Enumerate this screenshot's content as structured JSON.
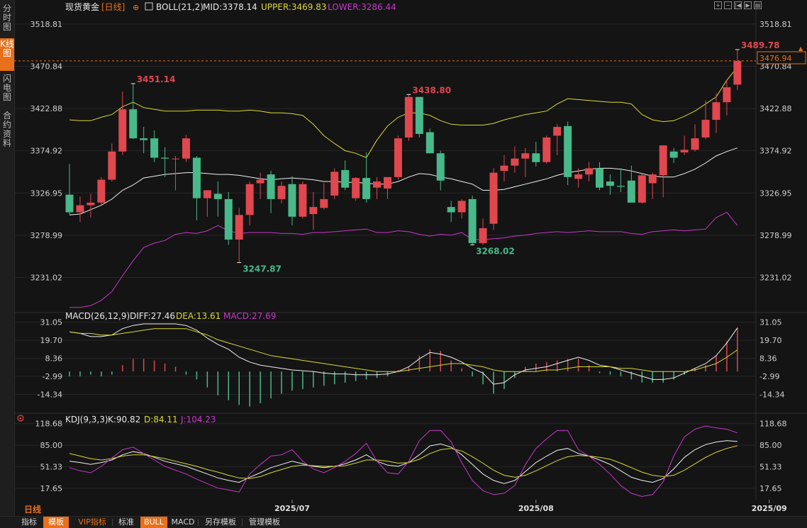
{
  "sidebar": {
    "tabs": [
      {
        "label": "分时图",
        "active": false
      },
      {
        "label": "K线图",
        "active": true
      },
      {
        "label": "闪电图",
        "active": false
      },
      {
        "label": "合约资料",
        "active": false
      }
    ]
  },
  "header": {
    "symbol": "现货黄金",
    "period": "[日线]",
    "boll_label": "BOLL(21,2)",
    "mid_label": "MID:3378.14",
    "upper_label": "UPPER:3469.83",
    "lower_label": "LOWER:3286.44"
  },
  "colors": {
    "background": "#141414",
    "up": "#e0474f",
    "down": "#48b98a",
    "mid": "#f0f0f0",
    "upper": "#d9d935",
    "lower": "#c838c8",
    "dea": "#d9d935",
    "macd": "#c838c8",
    "axis_text": "#cfcfcf",
    "accent": "#e8701a"
  },
  "macd_header": {
    "label": "MACD(26,12,9)",
    "diff": "DIFF:27.46",
    "dea": "DEA:13.61",
    "macd": "MACD:27.69"
  },
  "kdj_header": {
    "label": "KDJ(9,3,3)",
    "k": "K:90.82",
    "d": "D:84.11",
    "j": "J:104.23"
  },
  "period_label": "日线",
  "current_price_tag": "3476.94",
  "toolbar": {
    "items": [
      {
        "label": "指标",
        "active": false,
        "vip": false
      },
      {
        "label": "模板",
        "active": true,
        "vip": false
      },
      {
        "label": "VIP指标",
        "active": false,
        "vip": true
      },
      {
        "label": "标准",
        "active": false,
        "vip": false
      },
      {
        "label": "BULL",
        "active": true,
        "vip": false
      },
      {
        "label": "MACD",
        "active": false,
        "vip": false
      },
      {
        "label": "另存模板",
        "active": false,
        "vip": false
      },
      {
        "label": "管理模板",
        "active": false,
        "vip": false
      }
    ]
  },
  "chart_data": [
    {
      "type": "candlestick",
      "title": "现货黄金 日线",
      "ylim": [
        3200,
        3530
      ],
      "y_ticks": [
        "3518.81",
        "3470.84",
        "3422.88",
        "3374.92",
        "3326.95",
        "3278.99",
        "3231.02"
      ],
      "x_ticks": [
        {
          "index": 21,
          "label": "2025/07"
        },
        {
          "index": 44,
          "label": "2025/08"
        },
        {
          "index": 66,
          "label": "2025/09"
        }
      ],
      "candles": [
        [
          3325,
          3360,
          3302,
          3305
        ],
        [
          3305,
          3323,
          3294,
          3313
        ],
        [
          3313,
          3326,
          3299,
          3316
        ],
        [
          3316,
          3345,
          3313,
          3342
        ],
        [
          3342,
          3383,
          3340,
          3374
        ],
        [
          3374,
          3442,
          3370,
          3422
        ],
        [
          3422,
          3451.14,
          3388,
          3389
        ],
        [
          3389,
          3402,
          3372,
          3387
        ],
        [
          3389,
          3398,
          3362,
          3367
        ],
        [
          3367,
          3379,
          3345,
          3366
        ],
        [
          3366,
          3369,
          3330,
          3366
        ],
        [
          3366,
          3393,
          3362,
          3389
        ],
        [
          3367,
          3369,
          3296,
          3321
        ],
        [
          3321,
          3330,
          3300,
          3330
        ],
        [
          3326,
          3340,
          3300,
          3320
        ],
        [
          3320,
          3328,
          3268,
          3274
        ],
        [
          3274,
          3310,
          3247.87,
          3302
        ],
        [
          3302,
          3340,
          3290,
          3337
        ],
        [
          3338,
          3350,
          3320,
          3342
        ],
        [
          3348,
          3352,
          3304,
          3320
        ],
        [
          3320,
          3340,
          3315,
          3335
        ],
        [
          3337,
          3346,
          3290,
          3300
        ],
        [
          3300,
          3340,
          3298,
          3337
        ],
        [
          3303,
          3328,
          3285,
          3311
        ],
        [
          3310,
          3338,
          3308,
          3320
        ],
        [
          3324,
          3355,
          3320,
          3351
        ],
        [
          3353,
          3364,
          3330,
          3333
        ],
        [
          3321,
          3345,
          3318,
          3344
        ],
        [
          3344,
          3373,
          3316,
          3320
        ],
        [
          3333,
          3345,
          3320,
          3340
        ],
        [
          3332,
          3343,
          3320,
          3345
        ],
        [
          3345,
          3392,
          3342,
          3389
        ],
        [
          3390,
          3438.8,
          3386,
          3436
        ],
        [
          3436,
          3436,
          3390,
          3394
        ],
        [
          3396,
          3400,
          3372,
          3372
        ],
        [
          3372,
          3375,
          3330,
          3341
        ],
        [
          3311,
          3318,
          3294,
          3305
        ],
        [
          3305,
          3320,
          3298,
          3318
        ],
        [
          3320,
          3324,
          3268.02,
          3270
        ],
        [
          3270,
          3298,
          3268,
          3287
        ],
        [
          3292,
          3355,
          3285,
          3350
        ],
        [
          3352,
          3370,
          3340,
          3358
        ],
        [
          3358,
          3380,
          3350,
          3366
        ],
        [
          3366,
          3378,
          3345,
          3372
        ],
        [
          3372,
          3385,
          3357,
          3362
        ],
        [
          3362,
          3392,
          3360,
          3390
        ],
        [
          3392,
          3405,
          3370,
          3402
        ],
        [
          3403,
          3408,
          3336,
          3345
        ],
        [
          3343,
          3355,
          3333,
          3348
        ],
        [
          3348,
          3362,
          3340,
          3355
        ],
        [
          3355,
          3362,
          3330,
          3333
        ],
        [
          3340,
          3348,
          3325,
          3335
        ],
        [
          3335,
          3355,
          3328,
          3334
        ],
        [
          3341,
          3358,
          3322,
          3316
        ],
        [
          3316,
          3350,
          3315,
          3347
        ],
        [
          3338,
          3350,
          3320,
          3348
        ],
        [
          3347,
          3381,
          3322,
          3381
        ],
        [
          3374,
          3378,
          3361,
          3367
        ],
        [
          3373,
          3392,
          3370,
          3376
        ],
        [
          3376,
          3405,
          3374,
          3389
        ],
        [
          3390,
          3432,
          3388,
          3410
        ],
        [
          3410,
          3440,
          3395,
          3430
        ],
        [
          3430,
          3455,
          3415,
          3447
        ],
        [
          3450,
          3489.78,
          3444,
          3476.94
        ]
      ],
      "series": [
        {
          "name": "MID",
          "values": [
            3302,
            3303,
            3308,
            3313,
            3320,
            3330,
            3336,
            3344,
            3346,
            3348,
            3349,
            3350,
            3350,
            3349,
            3348,
            3348,
            3347,
            3345,
            3343,
            3342,
            3343,
            3344,
            3343,
            3342,
            3340,
            3340,
            3339,
            3339,
            3338,
            3337,
            3337,
            3340,
            3345,
            3349,
            3348,
            3345,
            3343,
            3340,
            3337,
            3330,
            3330,
            3331,
            3334,
            3337,
            3340,
            3343,
            3347,
            3350,
            3352,
            3354,
            3355,
            3355,
            3354,
            3352,
            3349,
            3346,
            3345,
            3345,
            3349,
            3354,
            3361,
            3369,
            3374,
            3378.14
          ]
        },
        {
          "name": "UPPER",
          "values": [
            3410,
            3409,
            3409,
            3413,
            3416,
            3425,
            3430,
            3424,
            3422,
            3420,
            3420,
            3420,
            3421,
            3421,
            3421,
            3420,
            3420,
            3421,
            3420,
            3418,
            3418,
            3417,
            3415,
            3405,
            3392,
            3383,
            3375,
            3372,
            3367,
            3387,
            3403,
            3413,
            3418,
            3418,
            3415,
            3409,
            3405,
            3404,
            3404,
            3404,
            3406,
            3410,
            3413,
            3416,
            3418,
            3420,
            3428,
            3434,
            3433,
            3432,
            3431,
            3430,
            3430,
            3428,
            3416,
            3410,
            3408,
            3409,
            3414,
            3420,
            3428,
            3436,
            3455,
            3469.83
          ]
        },
        {
          "name": "LOWER",
          "values": [
            3197,
            3197,
            3199,
            3205,
            3215,
            3233,
            3250,
            3265,
            3270,
            3273,
            3280,
            3282,
            3281,
            3284,
            3290,
            3284,
            3281,
            3282,
            3282,
            3282,
            3281,
            3281,
            3280,
            3282,
            3282,
            3283,
            3284,
            3285,
            3286,
            3282,
            3282,
            3284,
            3283,
            3280,
            3278,
            3280,
            3279,
            3282,
            3274,
            3274,
            3275,
            3276,
            3278,
            3279,
            3281,
            3282,
            3283,
            3282,
            3283,
            3284,
            3283,
            3283,
            3283,
            3281,
            3280,
            3283,
            3284,
            3285,
            3284,
            3285,
            3286,
            3299,
            3305,
            3290
          ]
        }
      ]
    },
    {
      "type": "bar",
      "title": "MACD(26,12,9)",
      "ylim": [
        -24,
        34
      ],
      "y_ticks": [
        "31.05",
        "19.70",
        "8.36",
        "-2.99",
        "-14.34"
      ],
      "series": [
        {
          "name": "DIFF",
          "values": [
            25,
            24,
            22,
            22,
            23,
            27,
            29,
            30,
            30,
            30,
            30,
            29,
            26,
            21,
            17,
            14,
            9,
            6,
            4,
            3,
            2,
            1,
            0.5,
            0,
            -1,
            -1.5,
            -1.5,
            -2,
            -2,
            -2,
            -1.5,
            0,
            3,
            8,
            12,
            11,
            9,
            6,
            2,
            -1,
            -8,
            -7,
            -2,
            1,
            2,
            3,
            5,
            7,
            9,
            7,
            4,
            3,
            1,
            -1,
            -3,
            -5,
            -5,
            -4,
            -1,
            2,
            5,
            10,
            18,
            27.46
          ]
        },
        {
          "name": "DEA",
          "values": [
            25,
            24,
            24,
            23,
            23,
            24,
            25,
            26,
            27,
            27,
            27,
            27,
            25,
            23,
            20,
            18,
            16,
            14,
            12,
            10,
            9,
            8,
            7,
            6,
            5,
            4,
            3,
            2,
            1,
            0,
            0,
            0,
            1,
            2,
            3,
            4,
            5,
            5,
            4,
            3,
            1,
            0,
            0,
            0,
            0,
            1,
            1,
            2,
            3,
            3,
            3,
            3,
            2,
            2,
            1,
            0,
            0,
            0,
            0,
            1,
            3,
            5,
            9,
            13.61
          ]
        },
        {
          "name": "MACD",
          "values": [
            -3,
            -3,
            -2,
            -3,
            -2,
            4,
            8,
            8,
            7,
            5,
            3,
            -2,
            -5,
            -10,
            -15,
            -18,
            -21,
            -22,
            -20,
            -17,
            -14,
            -12,
            -11,
            -10,
            -9,
            -8,
            -7,
            -6,
            -5,
            -4,
            -3,
            1,
            3,
            10,
            14,
            13,
            7,
            2,
            -3,
            -8,
            -14,
            -11,
            -4,
            3,
            5,
            6,
            7,
            8,
            8,
            4,
            -1,
            -2,
            -3,
            -5,
            -7,
            -7,
            -7,
            -5,
            -2,
            2,
            4,
            10,
            19,
            27.69
          ]
        }
      ]
    },
    {
      "type": "line",
      "title": "KDJ(9,3,3)",
      "ylim": [
        0,
        125
      ],
      "y_ticks": [
        "118.68",
        "85.00",
        "51.33",
        "17.65"
      ],
      "series": [
        {
          "name": "K",
          "values": [
            60,
            58,
            55,
            58,
            62,
            70,
            75,
            72,
            66,
            60,
            56,
            52,
            46,
            40,
            34,
            30,
            27,
            35,
            42,
            50,
            55,
            60,
            56,
            52,
            50,
            52,
            56,
            62,
            70,
            60,
            54,
            52,
            58,
            70,
            84,
            87,
            82,
            70,
            55,
            40,
            30,
            25,
            30,
            44,
            58,
            68,
            77,
            80,
            72,
            68,
            62,
            55,
            45,
            35,
            30,
            27,
            33,
            48,
            66,
            78,
            86,
            90,
            92,
            90.82
          ]
        },
        {
          "name": "D",
          "values": [
            72,
            68,
            64,
            62,
            64,
            68,
            70,
            70,
            67,
            64,
            60,
            56,
            52,
            47,
            43,
            38,
            34,
            33,
            36,
            42,
            47,
            52,
            54,
            53,
            52,
            52,
            53,
            57,
            62,
            62,
            60,
            57,
            58,
            63,
            72,
            78,
            80,
            76,
            67,
            57,
            46,
            38,
            35,
            38,
            45,
            53,
            61,
            67,
            69,
            68,
            66,
            63,
            57,
            50,
            43,
            38,
            36,
            38,
            46,
            56,
            66,
            74,
            80,
            84.11
          ]
        },
        {
          "name": "J",
          "values": [
            50,
            45,
            42,
            52,
            65,
            78,
            82,
            72,
            62,
            52,
            46,
            40,
            32,
            25,
            18,
            15,
            12,
            40,
            55,
            68,
            70,
            78,
            60,
            48,
            42,
            50,
            60,
            72,
            88,
            60,
            42,
            40,
            60,
            92,
            108,
            108,
            90,
            58,
            30,
            14,
            8,
            10,
            22,
            55,
            80,
            95,
            108,
            108,
            78,
            68,
            55,
            40,
            22,
            10,
            5,
            8,
            28,
            68,
            98,
            110,
            115,
            112,
            110,
            104.23
          ]
        }
      ]
    }
  ]
}
